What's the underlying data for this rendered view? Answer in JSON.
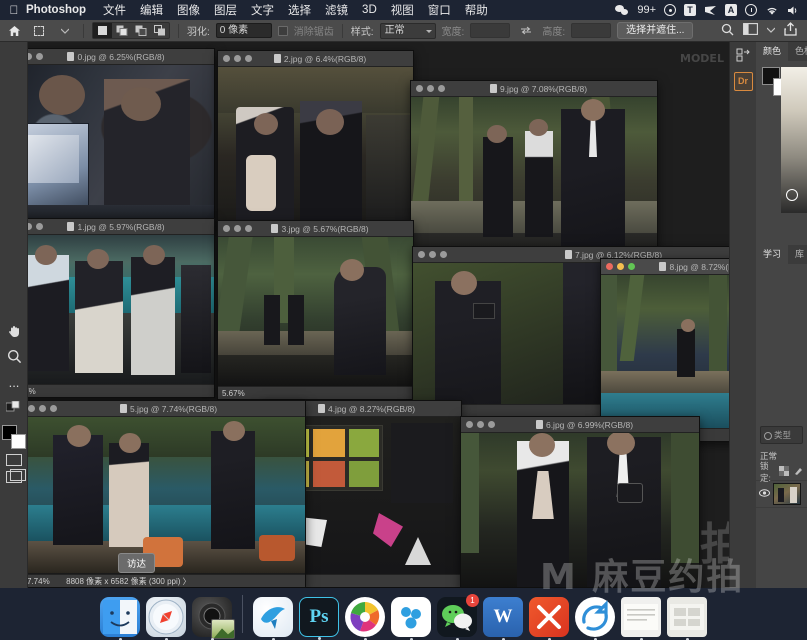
{
  "menubar": {
    "apple": "",
    "app_name": "Photoshop",
    "items": [
      "文件",
      "编辑",
      "图像",
      "图层",
      "文字",
      "选择",
      "滤镜",
      "3D",
      "视图",
      "窗口",
      "帮助"
    ],
    "tray": {
      "wechat_count": "99+",
      "text_icon": "T",
      "input_icon": "A"
    }
  },
  "options_bar": {
    "home_icon": "home-icon",
    "tool_icon": "marquee-tool-icon",
    "feather_label": "羽化:",
    "feather_value": "0 像素",
    "antialias_label": "消除锯齿",
    "style_label": "样式:",
    "style_value": "正常",
    "width_label": "宽度:",
    "width_value": "",
    "height_label": "高度:",
    "height_value": "",
    "select_mask_button": "选择并遮住...",
    "search_icon": "search-icon",
    "workspace_icon": "workspace-icon",
    "share_icon": "share-icon"
  },
  "toolbar": {
    "tools": [
      "hand-tool",
      "zoom-tool",
      "more-tools"
    ],
    "more_label": "...",
    "foreground_color": "#000000",
    "background_color": "#ffffff"
  },
  "windows": [
    {
      "id": "w0",
      "title": "0.jpg @ 6.25%(RGB/8)",
      "zoom": "6.25%",
      "active": false
    },
    {
      "id": "w2",
      "title": "2.jpg @ 6.4%(RGB/8)",
      "zoom": "6.4%",
      "active": false
    },
    {
      "id": "w9",
      "title": "9.jpg @ 7.08%(RGB/8)",
      "zoom": "7.08%",
      "active": false
    },
    {
      "id": "w1",
      "title": "1.jpg @ 5.97%(RGB/8)",
      "zoom": "5.97%",
      "active": false
    },
    {
      "id": "w3",
      "title": "3.jpg @ 5.67%(RGB/8)",
      "zoom": "5.67%",
      "active": false
    },
    {
      "id": "w7",
      "title": "7.jpg @ 6.12%(RGB/8)",
      "zoom": "6.12%",
      "active": false
    },
    {
      "id": "w8",
      "title": "8.jpg @ 8.72%(RGB/8)",
      "zoom": "8.72%",
      "active": true
    },
    {
      "id": "w5",
      "title": "5.jpg @ 7.74%(RGB/8)",
      "zoom": "7.74%",
      "active": false
    },
    {
      "id": "w4",
      "title": "4.jpg @ 8.27%(RGB/8)",
      "zoom": "8.27%",
      "active": false
    },
    {
      "id": "w6",
      "title": "6.jpg @ 6.99%(RGB/8)",
      "zoom": "6.99%",
      "active": false
    }
  ],
  "status_bar": {
    "zoom": "7.74%",
    "dimensions": "8808 像素 x 6582 像素 (300 ppi)",
    "arrow": "〉"
  },
  "tooltip": {
    "label": "访达"
  },
  "right_panel": {
    "rail_icons": [
      "panel-collapse-icon",
      "discover-icon"
    ],
    "discover_label": "Dr",
    "tabs_top": [
      "颜色",
      "色板"
    ],
    "tabs_mid": [
      "学习",
      "库"
    ],
    "active_tab_top": "颜色",
    "active_tab_mid": "学习"
  },
  "layers_panel": {
    "search_placeholder": "类型",
    "blend_mode": "正常",
    "lock_label": "锁定:",
    "eye_icon": "eye-icon",
    "layer_name": ""
  },
  "watermarks": {
    "brand": "M 麻豆约拍",
    "mid": "拍",
    "faint": "MODEL"
  },
  "dock": {
    "items": [
      {
        "name": "finder",
        "label": "访达"
      },
      {
        "name": "safari",
        "label": "Safari"
      },
      {
        "name": "camera-app",
        "label": "相机"
      },
      {
        "name": "preview-app",
        "label": "预览"
      },
      {
        "name": "bird-app",
        "label": "闪传"
      },
      {
        "name": "photoshop",
        "label": "Ps"
      },
      {
        "name": "photos-app",
        "label": "照片"
      },
      {
        "name": "meitu-app",
        "label": "美图"
      },
      {
        "name": "wechat",
        "label": "微信",
        "badge": "1"
      },
      {
        "name": "wps-writer",
        "label": "W"
      },
      {
        "name": "xmind-app",
        "label": "XMind"
      },
      {
        "name": "sync-app",
        "label": "同步"
      },
      {
        "name": "notes-app",
        "label": "便笺"
      },
      {
        "name": "files-app",
        "label": "文件"
      }
    ]
  }
}
